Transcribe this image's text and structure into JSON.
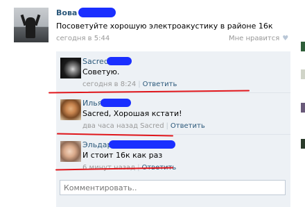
{
  "post": {
    "author": "Вова",
    "text": "Посоветуйте хорошую электроакустику в районе 16к",
    "time": "сегодня в 5:44",
    "like_label": "Мне нравится",
    "heart_glyph": "♥"
  },
  "replies": [
    {
      "name": "Sacred",
      "text": "Советую.",
      "time": "сегодня в 8:24",
      "separator": "|",
      "reply_label": "Ответить",
      "reply_to": ""
    },
    {
      "name": "Илья",
      "text": "Sacred, Хорошая кстати!",
      "time": "два часа назад",
      "reply_to": "Sacred",
      "separator": "|",
      "reply_label": "Ответить"
    },
    {
      "name": "Эльдар",
      "text": "И стоит 16к как раз",
      "time": "6 минут назад",
      "separator": "|",
      "reply_label": "Ответить",
      "reply_to": ""
    }
  ],
  "comment": {
    "placeholder": "Комментировать.."
  },
  "colors": {
    "link": "#2b587a",
    "reply_bg": "#edf1f5",
    "annotation_red": "#e0161b",
    "redaction_blue": "#1a2fff"
  }
}
